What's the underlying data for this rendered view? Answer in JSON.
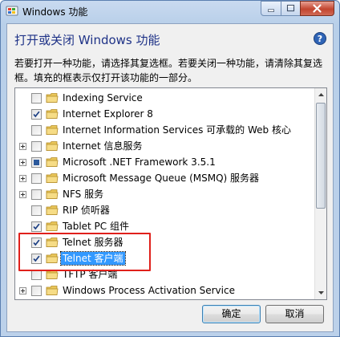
{
  "window": {
    "title": "Windows 功能",
    "heading": "打开或关闭 Windows 功能",
    "description": "若要打开一种功能，请选择其复选框。若要关闭一种功能，请清除其复选框。填充的框表示仅打开该功能的一部分。"
  },
  "colors": {
    "accent_heading": "#1e3287",
    "selection": "#3399ff",
    "annotation_box": "#e0201b"
  },
  "features": [
    {
      "label": "Indexing Service",
      "state": "unchecked",
      "expandable": false
    },
    {
      "label": "Internet Explorer 8",
      "state": "checked",
      "expandable": false
    },
    {
      "label": "Internet Information Services 可承载的 Web 核心",
      "state": "unchecked",
      "expandable": false
    },
    {
      "label": "Internet 信息服务",
      "state": "unchecked",
      "expandable": true
    },
    {
      "label": "Microsoft .NET Framework 3.5.1",
      "state": "partial",
      "expandable": true
    },
    {
      "label": "Microsoft Message Queue (MSMQ) 服务器",
      "state": "unchecked",
      "expandable": true
    },
    {
      "label": "NFS 服务",
      "state": "unchecked",
      "expandable": true
    },
    {
      "label": "RIP 侦听器",
      "state": "unchecked",
      "expandable": false
    },
    {
      "label": "Tablet PC 组件",
      "state": "checked",
      "expandable": false
    },
    {
      "label": "Telnet 服务器",
      "state": "checked",
      "expandable": false
    },
    {
      "label": "Telnet 客户端",
      "state": "checked",
      "expandable": false,
      "selected": true
    },
    {
      "label": "TFTP 客户端",
      "state": "unchecked",
      "expandable": false
    },
    {
      "label": "Windows Process Activation Service",
      "state": "unchecked",
      "expandable": true
    }
  ],
  "buttons": {
    "ok": "确定",
    "cancel": "取消"
  },
  "icons": {
    "app": "windows-features-icon",
    "help": "help-icon",
    "folder": "folder-icon"
  }
}
